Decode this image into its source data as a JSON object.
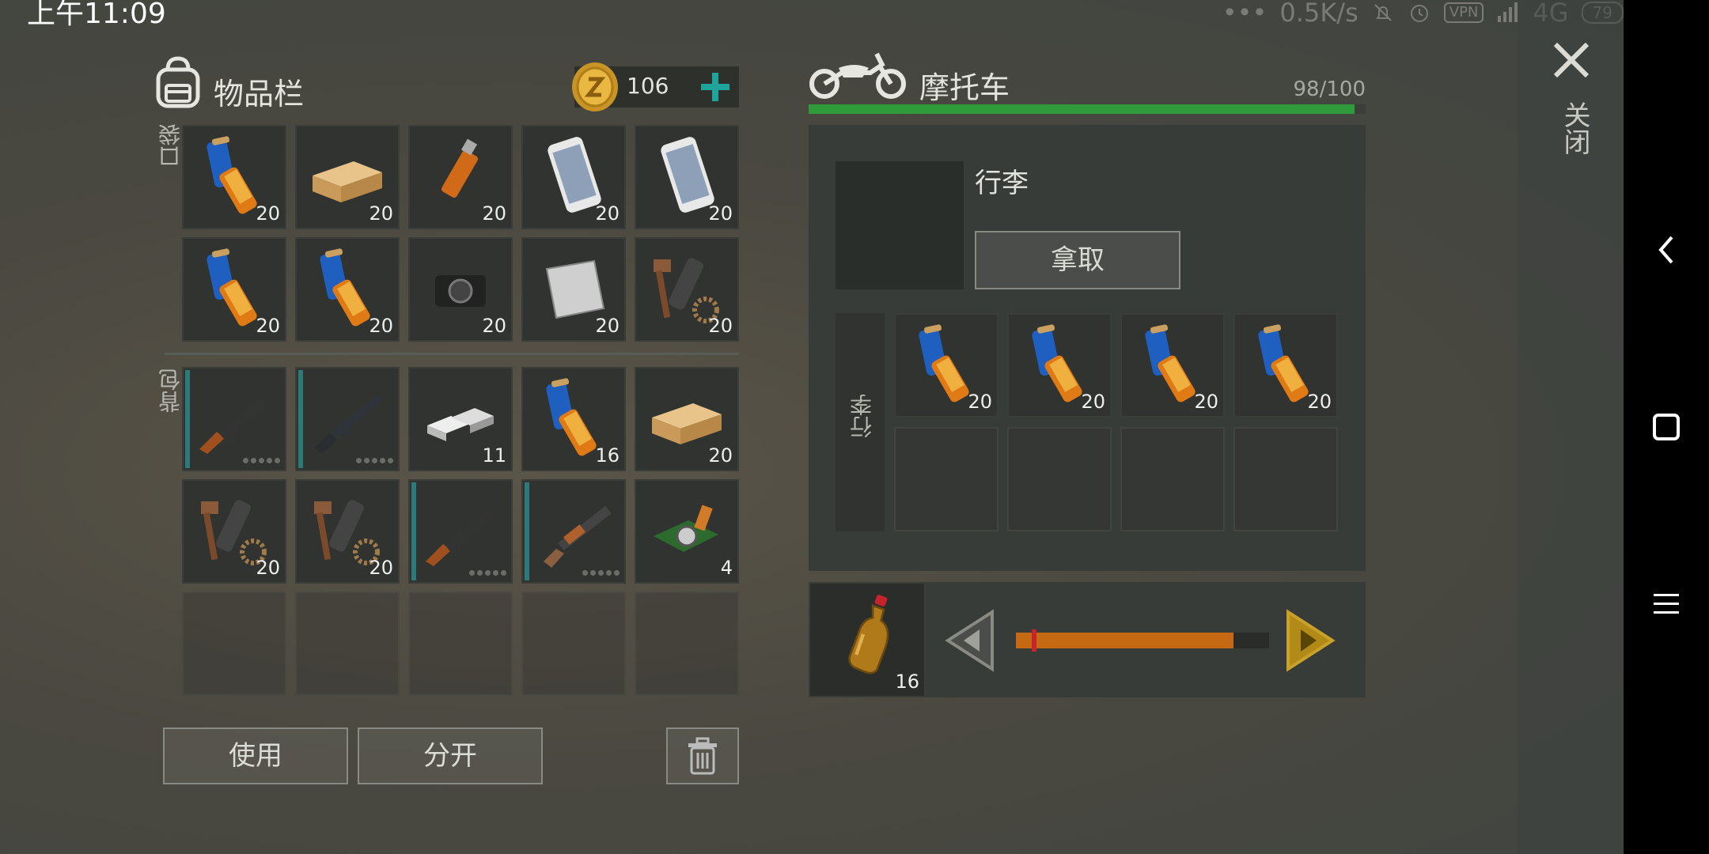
{
  "status_bar": {
    "time": "上午11:09",
    "dots": "•••",
    "speed": "0.5K/s",
    "vpn": "VPN",
    "network": "4G",
    "battery": "79"
  },
  "inventory": {
    "title": "物品栏",
    "coins": "106",
    "pocket_label": "口袋",
    "backpack_label": "背包",
    "pocket": [
      {
        "item": "batteries",
        "count": "20"
      },
      {
        "item": "wood-plank",
        "count": "20"
      },
      {
        "item": "usb-stick",
        "count": "20"
      },
      {
        "item": "smartphone",
        "count": "20"
      },
      {
        "item": "smartphone",
        "count": "20"
      },
      {
        "item": "batteries",
        "count": "20"
      },
      {
        "item": "batteries",
        "count": "20"
      },
      {
        "item": "camera",
        "count": "20"
      },
      {
        "item": "metal-sheet",
        "count": "20"
      },
      {
        "item": "weapon-parts",
        "count": "20"
      }
    ],
    "backpack": [
      {
        "item": "ak-rifle",
        "count": ""
      },
      {
        "item": "m16-rifle",
        "count": ""
      },
      {
        "item": "silver-ingots",
        "count": "11"
      },
      {
        "item": "batteries",
        "count": "16"
      },
      {
        "item": "wood-plank",
        "count": "20"
      },
      {
        "item": "weapon-parts",
        "count": "20"
      },
      {
        "item": "weapon-parts",
        "count": "20"
      },
      {
        "item": "ak-rifle",
        "count": ""
      },
      {
        "item": "shotgun",
        "count": ""
      },
      {
        "item": "circuit-board",
        "count": "4"
      }
    ],
    "use_button": "使用",
    "split_button": "分开"
  },
  "vehicle": {
    "title": "摩托车",
    "durability": "98/100",
    "durability_fraction": 0.98,
    "luggage_label": "行李",
    "take_button": "拿取",
    "side_label": "行李",
    "storage": [
      {
        "item": "batteries",
        "count": "20"
      },
      {
        "item": "batteries",
        "count": "20"
      },
      {
        "item": "batteries",
        "count": "20"
      },
      {
        "item": "batteries",
        "count": "20"
      }
    ],
    "fuel_item": "fuel-bottle",
    "fuel_count": "16",
    "fuel_level_fraction": 0.86
  },
  "close_label": "关闭",
  "colors": {
    "accent_green": "#2f9b3a",
    "accent_teal": "#1fa39a",
    "orange_bar": "#c56a12",
    "gold": "#c9a028"
  }
}
